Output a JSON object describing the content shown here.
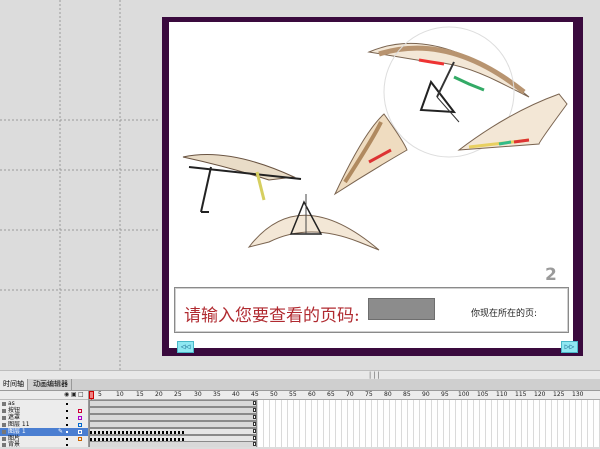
{
  "stage": {
    "page_number": "2",
    "input_label": "请输入您要查看的页码:",
    "page_input_value": "",
    "current_page_label": "你现在所在的页:",
    "prev_button": "◁◁",
    "next_button": "▷▷"
  },
  "timeline": {
    "tabs": [
      "时间轴",
      "动画编辑器"
    ],
    "ruler": [
      "5",
      "10",
      "15",
      "20",
      "25",
      "30",
      "35",
      "40",
      "45",
      "50",
      "55",
      "60",
      "65",
      "70",
      "75",
      "80",
      "85",
      "90",
      "95",
      "100",
      "105",
      "110",
      "115",
      "120",
      "125",
      "130"
    ],
    "layers": [
      {
        "name": "as"
      },
      {
        "name": "按钮"
      },
      {
        "name": "遮罩"
      },
      {
        "name": "图层 11"
      },
      {
        "name": "图层 1"
      },
      {
        "name": "图片"
      },
      {
        "name": "背景"
      }
    ],
    "selected_layer_index": 4
  },
  "colors": {
    "stage_border": "#3a0a3e",
    "input_label": "#b02a30",
    "nav_button": "#8fe8f2"
  }
}
